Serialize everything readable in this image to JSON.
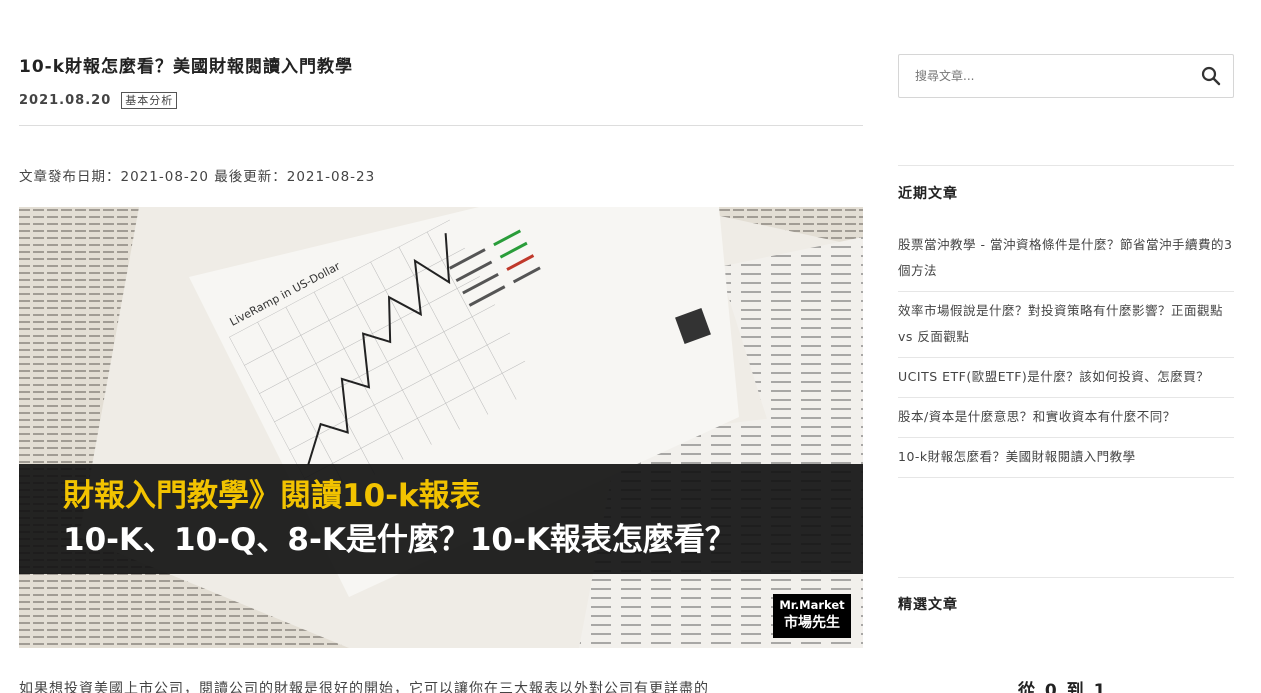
{
  "post": {
    "title": "10-k財報怎麼看？美國財報閱讀入門教學",
    "date": "2021.08.20",
    "category": "基本分析",
    "published_line": "文章發布日期：2021-08-20 最後更新：2021-08-23",
    "hero": {
      "chart_label": "LiveRamp in US-Dollar",
      "banner_line1": "財報入門教學》閱讀10-k報表",
      "banner_line2": "10-K、10-Q、8-K是什麼？10-K報表怎麼看？",
      "brand_en": "Mr.Market",
      "brand_zh": "市場先生",
      "accent_color": "#f2c300"
    },
    "body_first_line": "如果想投資美國上市公司，閱讀公司的財報是很好的開始，它可以讓你在三大報表以外對公司有更詳盡的"
  },
  "sidebar": {
    "search": {
      "placeholder": "搜尋文章...",
      "icon": "search-icon"
    },
    "recent_title": "近期文章",
    "recent_posts": [
      "股票當沖教學 - 當沖資格條件是什麼？節省當沖手續費的3個方法",
      "效率市場假說是什麼？對投資策略有什麼影響？正面觀點 vs 反面觀點",
      "UCITS ETF(歐盟ETF)是什麼？該如何投資、怎麼買？",
      "股本/資本是什麼意思？和實收資本有什麼不同？",
      "10-k財報怎麼看？美國財報閱讀入門教學"
    ],
    "featured_title": "精選文章",
    "featured_preview": "從 0 到 1"
  }
}
